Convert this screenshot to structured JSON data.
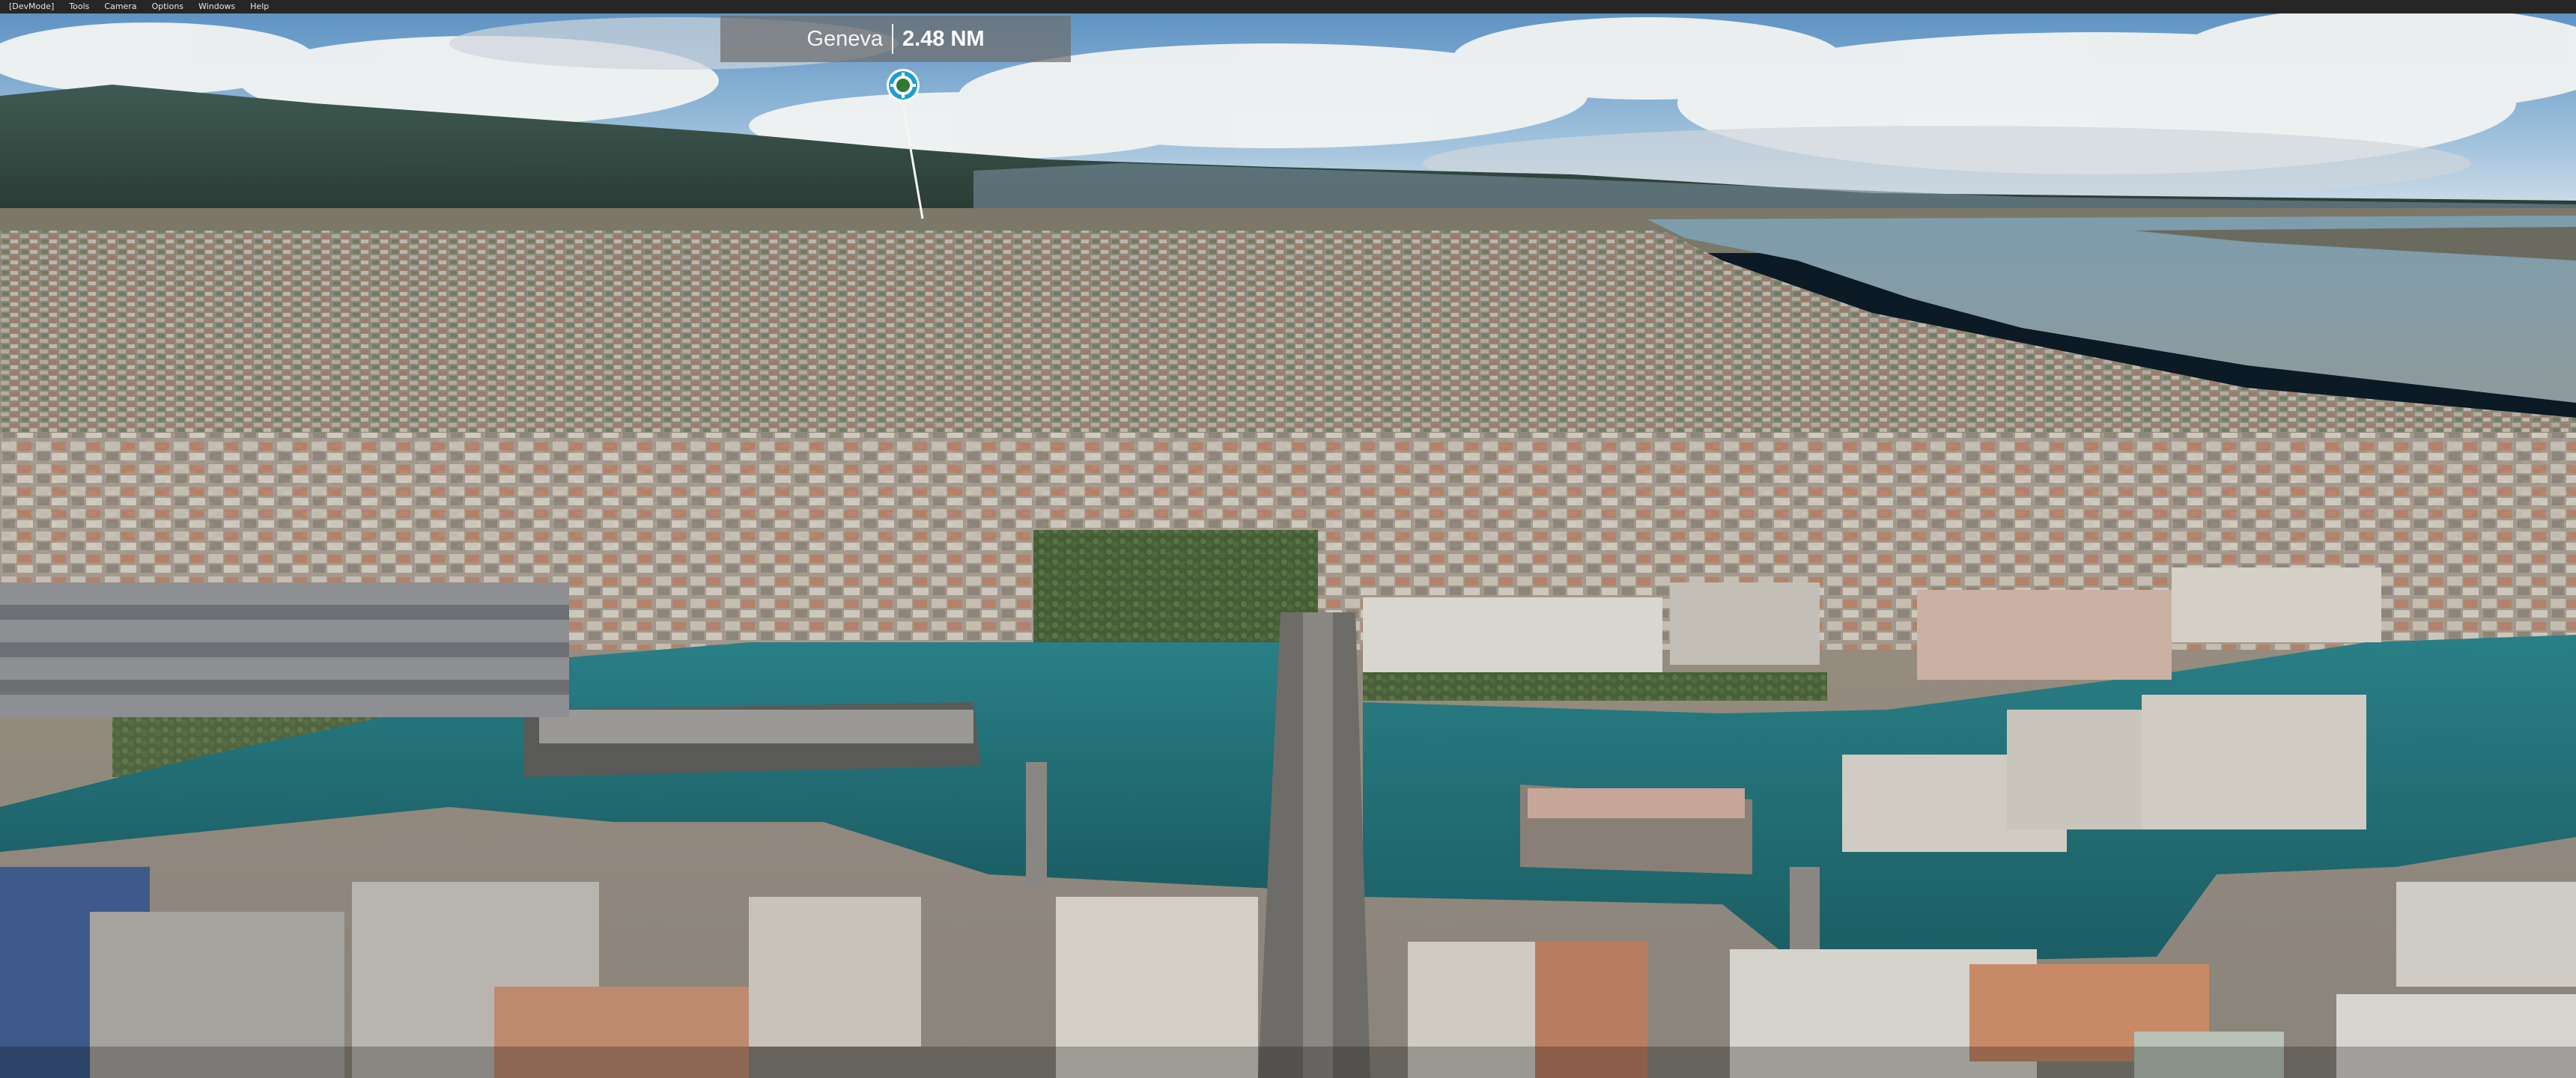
{
  "menubar": {
    "items": [
      {
        "label": "[DevMode]"
      },
      {
        "label": "Tools"
      },
      {
        "label": "Camera"
      },
      {
        "label": "Options"
      },
      {
        "label": "Windows"
      },
      {
        "label": "Help"
      }
    ]
  },
  "poi": {
    "name": "Geneva",
    "distance": "2.48 NM",
    "icon": "target-marker-icon"
  },
  "colors": {
    "menubar_bg": "#262626",
    "poi_bg": "#6e6e6e",
    "marker_ring": "#1e9cd6",
    "marker_core": "#2f7a35",
    "water": "#1f6b73"
  }
}
